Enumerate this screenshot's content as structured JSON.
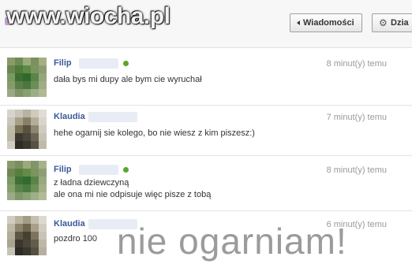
{
  "watermark": {
    "site": "www.wiocha.pl",
    "caption": "nie ogarniam!"
  },
  "toolbar": {
    "back_label": "Wiadomości",
    "actions_label": "Dzia"
  },
  "colors": {
    "link": "#3b5998",
    "online": "#5aa62b",
    "time": "#9a9a9a"
  },
  "messages": [
    {
      "sender": "Filip",
      "online": true,
      "time": "8 minut(y) temu",
      "lines": [
        "dała bys mi dupy ale bym cie wyruchał"
      ]
    },
    {
      "sender": "Klaudia",
      "online": false,
      "time": "7 minut(y) temu",
      "lines": [
        "hehe ogarnij sie kolego, bo nie wiesz z kim piszesz:)"
      ]
    },
    {
      "sender": "Filip",
      "online": true,
      "time": "8 minut(y) temu",
      "lines": [
        "z ładna dziewczyną",
        "ale ona mi nie odpisuje więc pisze z tobą"
      ]
    },
    {
      "sender": "Klaudia",
      "online": false,
      "time": "6 minut(y) temu",
      "lines": [
        "pozdro 100"
      ]
    }
  ]
}
